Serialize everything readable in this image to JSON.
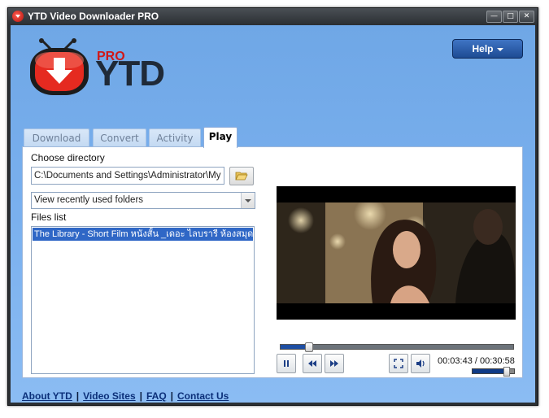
{
  "window": {
    "title": "YTD Video Downloader PRO"
  },
  "logo": {
    "badge": "PRO",
    "name": "YTD"
  },
  "header": {
    "help_label": "Help"
  },
  "tabs": [
    {
      "label": "Download",
      "active": false
    },
    {
      "label": "Convert",
      "active": false
    },
    {
      "label": "Activity",
      "active": false
    },
    {
      "label": "Play",
      "active": true
    }
  ],
  "play": {
    "choose_directory_label": "Choose directory",
    "directory_value": "C:\\Documents and Settings\\Administrator\\My Do",
    "folder_dropdown_value": "View recently used folders",
    "files_list_label": "Files list",
    "files": [
      {
        "name": "The Library - Short Film หนังสั้น _เดอะ ไลบรารี ห้องสมุดแ",
        "selected": true
      }
    ],
    "player": {
      "time_display": "00:03:43 / 00:30:58",
      "progress_fraction": 0.12,
      "volume_fraction": 0.8
    }
  },
  "footer": {
    "links": [
      "About YTD",
      "Video Sites",
      "FAQ",
      "Contact Us"
    ],
    "separator": "|"
  },
  "colors": {
    "background_gradient_top": "#6fa7e6",
    "accent_blue": "#2f67c6",
    "logo_red": "#d01818"
  }
}
